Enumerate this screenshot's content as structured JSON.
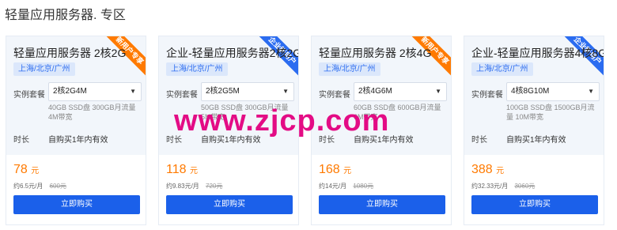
{
  "page": {
    "section_title": "轻量应用服务器. 专区",
    "watermark": "www.zjcp.com"
  },
  "colors": {
    "accent": "#1b60ea",
    "price": "#ff7a00",
    "badge_orange": "#ff7a00",
    "badge_blue": "#2b6cf0",
    "watermark": "#e3007f"
  },
  "labels": {
    "spec": "实例套餐",
    "duration": "时长",
    "duration_value": "自购买1年内有效",
    "currency": "元",
    "buy": "立即购买"
  },
  "cards": [
    {
      "badge": "新用户专享",
      "badge_color": "orange",
      "title": "轻量应用服务器 2核2G",
      "region": "上海/北京/广州",
      "spec": "2核2G4M",
      "spec_desc": "40GB SSD盘 300GB月流量 4M带宽",
      "price": "78",
      "monthly": "约6.5元/月",
      "original": "600元"
    },
    {
      "badge": "企业新用户",
      "badge_color": "blue",
      "title": "企业-轻量应用服务器2核2G",
      "region": "上海/北京/广州",
      "spec": "2核2G5M",
      "spec_desc": "50GB SSD盘 300GB月流量 5M带宽",
      "price": "118",
      "monthly": "约9.83元/月",
      "original": "720元"
    },
    {
      "badge": "新用户专享",
      "badge_color": "orange",
      "title": "轻量应用服务器 2核4G",
      "region": "上海/北京/广州",
      "spec": "2核4G6M",
      "spec_desc": "60GB SSD盘 600GB月流量 6M带宽",
      "price": "168",
      "monthly": "约14元/月",
      "original": "1080元"
    },
    {
      "badge": "企业新用户",
      "badge_color": "blue",
      "title": "企业-轻量应用服务器4核8G",
      "region": "上海/北京/广州",
      "spec": "4核8G10M",
      "spec_desc": "100GB SSD盘 1500GB月流量 10M带宽",
      "price": "388",
      "monthly": "约32.33元/月",
      "original": "3060元"
    }
  ]
}
